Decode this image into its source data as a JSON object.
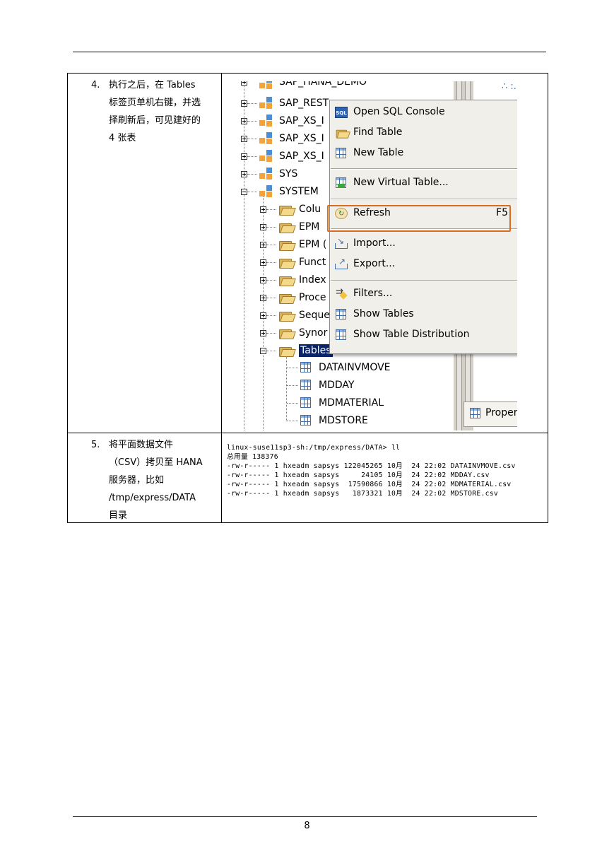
{
  "page_number": "8",
  "steps": [
    {
      "num": "4.",
      "lines": [
        "执行之后，在 Tables",
        "标签页单机右键，并选",
        "择刷新后，可见建好的",
        "4 张表"
      ]
    },
    {
      "num": "5.",
      "lines": [
        "将平面数据文件",
        "（CSV）拷贝至 HANA",
        "服务器，比如",
        "/tmp/express/DATA",
        "目录"
      ]
    }
  ],
  "tree": {
    "clipped_top": "SAP_HANA_DEMO",
    "schemas": [
      "SAP_REST",
      "SAP_XS_I",
      "SAP_XS_I",
      "SAP_XS_I",
      "SYS",
      "SYSTEM"
    ],
    "folders": [
      "Colu",
      "EPM",
      "EPM (",
      "Funct",
      "Index",
      "Proce",
      "Seque",
      "Synor",
      "Tables"
    ],
    "tables": [
      "DATAINVMOVE",
      "MDDAY",
      "MDMATERIAL",
      "MDSTORE"
    ],
    "panel_label": "Proper",
    "corner_mark": "∴ :."
  },
  "context_menu": {
    "items": [
      {
        "label": "Open SQL Console",
        "icon": "sql-console-icon"
      },
      {
        "label": "Find Table",
        "icon": "find-table-icon"
      },
      {
        "label": "New Table",
        "icon": "new-table-icon"
      },
      {
        "label": "New Virtual Table...",
        "icon": "virtual-table-icon"
      },
      {
        "label": "Refresh",
        "shortcut": "F5",
        "icon": "refresh-icon"
      },
      {
        "label": "Import...",
        "icon": "import-icon"
      },
      {
        "label": "Export...",
        "icon": "export-icon"
      },
      {
        "label": "Filters...",
        "icon": "filter-icon"
      },
      {
        "label": "Show Tables",
        "icon": "table-icon"
      },
      {
        "label": "Show Table Distribution",
        "icon": "table-icon"
      }
    ],
    "highlight_color": "#d96c1f"
  },
  "terminal": {
    "lines": [
      "linux-suse11sp3-sh:/tmp/express/DATA> ll",
      "总用量 138376",
      "-rw-r----- 1 hxeadm sapsys 122045265 10月  24 22:02 DATAINVMOVE.csv",
      "-rw-r----- 1 hxeadm sapsys     24105 10月  24 22:02 MDDAY.csv",
      "-rw-r----- 1 hxeadm sapsys  17590866 10月  24 22:02 MDMATERIAL.csv",
      "-rw-r----- 1 hxeadm sapsys   1873321 10月  24 22:02 MDSTORE.csv"
    ]
  }
}
